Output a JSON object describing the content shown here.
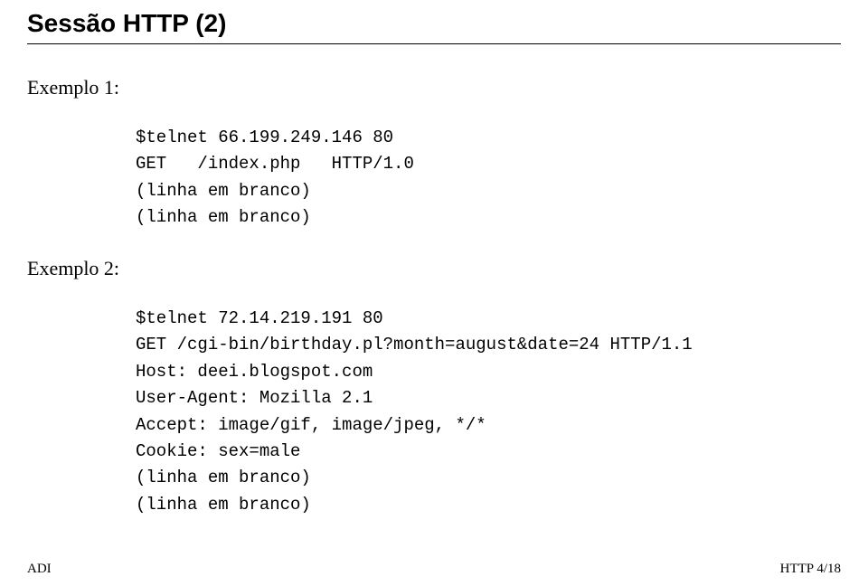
{
  "title": "Sessão HTTP (2)",
  "example1": {
    "label": "Exemplo 1:",
    "code": "$telnet 66.199.249.146 80\nGET   /index.php   HTTP/1.0\n(linha em branco)\n(linha em branco)"
  },
  "example2": {
    "label": "Exemplo 2:",
    "code": "$telnet 72.14.219.191 80\nGET /cgi-bin/birthday.pl?month=august&date=24 HTTP/1.1\nHost: deei.blogspot.com\nUser-Agent: Mozilla 2.1\nAccept: image/gif, image/jpeg, */*\nCookie: sex=male\n(linha em branco)\n(linha em branco)"
  },
  "footer": {
    "left": "ADI",
    "right": "HTTP 4/18"
  }
}
